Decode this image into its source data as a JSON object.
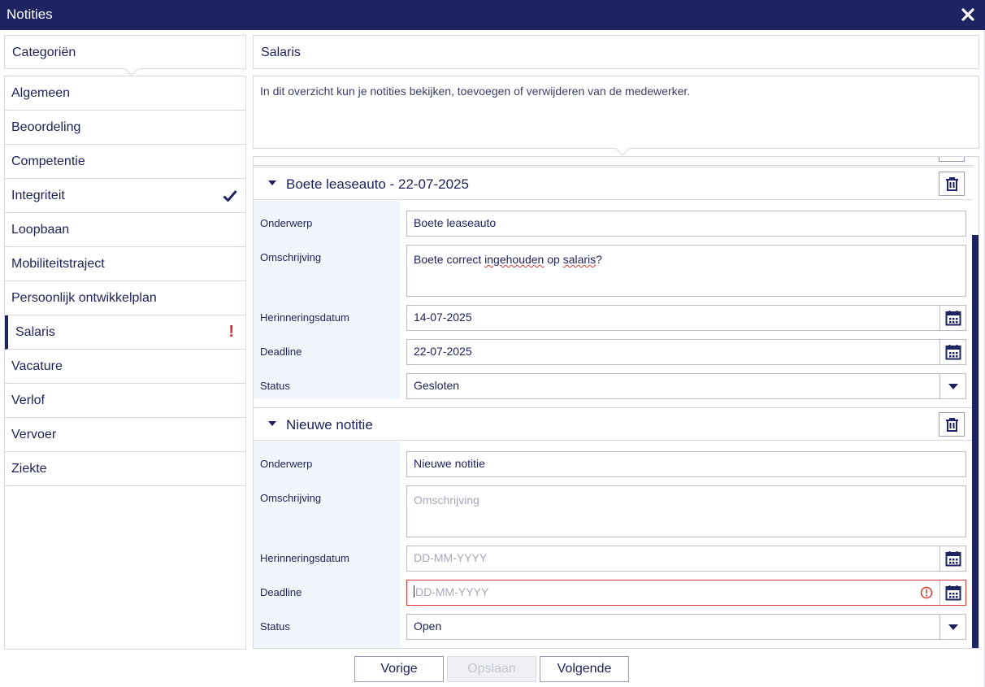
{
  "window": {
    "title": "Notities"
  },
  "categories": {
    "header": "Categoriën",
    "items": [
      {
        "label": "Algemeen"
      },
      {
        "label": "Beoordeling"
      },
      {
        "label": "Competentie"
      },
      {
        "label": "Integriteit",
        "marker": "check-icon"
      },
      {
        "label": "Loopbaan"
      },
      {
        "label": "Mobiliteitstraject"
      },
      {
        "label": "Persoonlijk ontwikkelplan"
      },
      {
        "label": "Salaris",
        "marker": "exclamation",
        "marker_text": "!",
        "active": true
      },
      {
        "label": "Vacature"
      },
      {
        "label": "Verlof"
      },
      {
        "label": "Vervoer"
      },
      {
        "label": "Ziekte"
      }
    ]
  },
  "section": {
    "title": "Salaris",
    "description": "In dit overzicht kun je notities bekijken, toevoegen of verwijderen van de medewerker."
  },
  "labels": {
    "subject": "Onderwerp",
    "description": "Omschrijving",
    "reminder": "Herinneringsdatum",
    "deadline": "Deadline",
    "status": "Status"
  },
  "notes": [
    {
      "title": "Boete leaseauto - 22-07-2025",
      "subject": "Boete leaseauto",
      "description_parts": [
        "Boete correct ",
        "ingehouden",
        " op ",
        "salaris",
        "?"
      ],
      "reminder": "14-07-2025",
      "deadline": "22-07-2025",
      "status": "Gesloten"
    },
    {
      "title": "Nieuwe notitie",
      "subject": "Nieuwe notitie",
      "description_placeholder": "Omschrijving",
      "reminder_placeholder": "DD-MM-YYYY",
      "deadline_placeholder": "DD-MM-YYYY",
      "status": "Open"
    }
  ],
  "buttons": {
    "prev": "Vorige",
    "save": "Opslaan",
    "next": "Volgende"
  },
  "colors": {
    "header_bg": "#1d2461",
    "text": "#1d2059",
    "error": "#e0262d",
    "label_bg": "#f0f6fc"
  }
}
